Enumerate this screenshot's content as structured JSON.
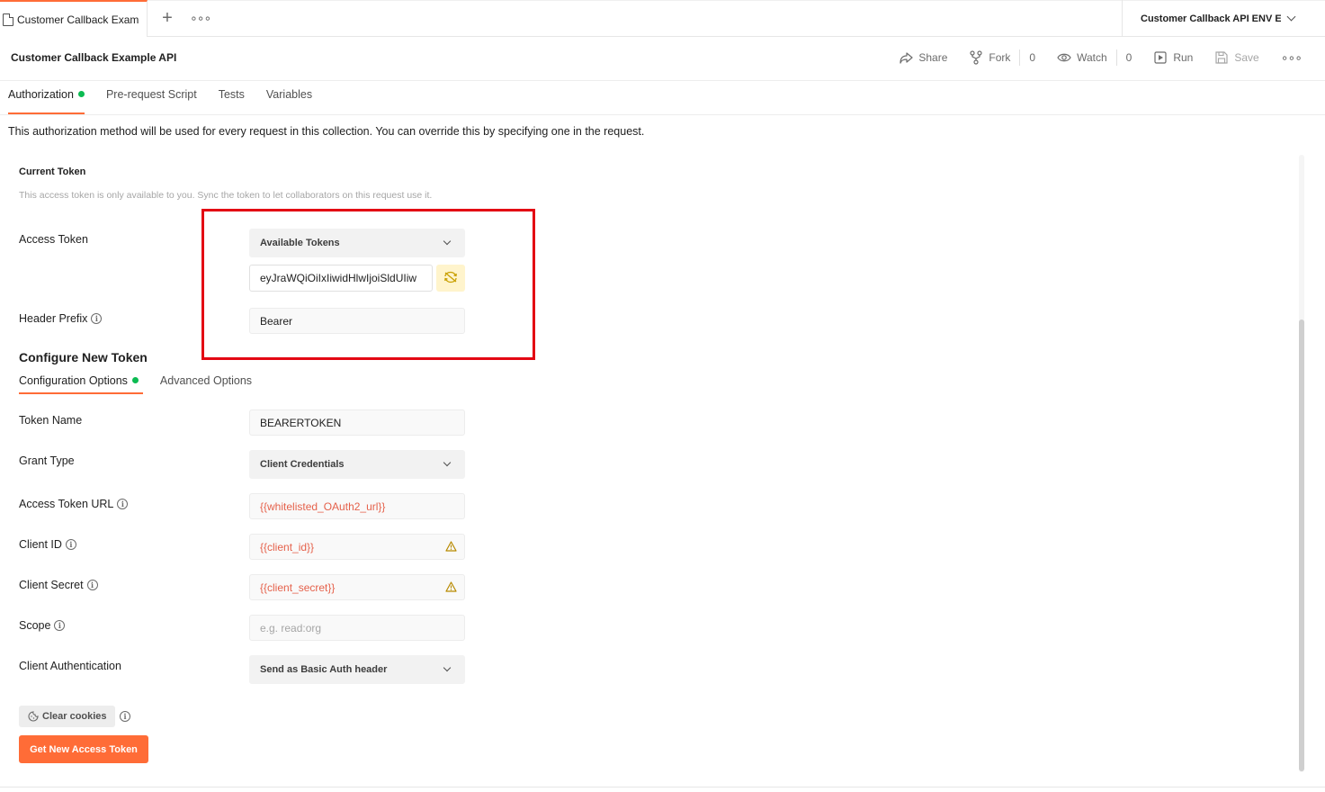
{
  "tabs": {
    "active_tab_label": "Customer Callback Example API",
    "new_tab_icon": "plus-icon",
    "more_icon": "more-horizontal-icon"
  },
  "environment": {
    "selected": "Customer Callback API ENV Example"
  },
  "header": {
    "title": "Customer Callback Example API",
    "share_label": "Share",
    "fork_label": "Fork",
    "fork_count": "0",
    "watch_label": "Watch",
    "watch_count": "0",
    "run_label": "Run",
    "save_label": "Save"
  },
  "subtabs": [
    "Authorization",
    "Pre-request Script",
    "Tests",
    "Variables"
  ],
  "description": "This authorization method will be used for every request in this collection. You can override this by specifying one in the request.",
  "current_token": {
    "heading": "Current Token",
    "hint": "This access token is only available to you. Sync the token to let collaborators on this request use it.",
    "access_token_label": "Access Token",
    "available_tokens": "Available Tokens",
    "token_value": "eyJraWQiOiIxIiwidHlwIjoiSldUIiw",
    "header_prefix_label": "Header Prefix",
    "header_prefix_value": "Bearer"
  },
  "configure": {
    "heading": "Configure New Token",
    "tabs": [
      "Configuration Options",
      "Advanced Options"
    ],
    "token_name_label": "Token Name",
    "token_name_value": "BEARERTOKEN",
    "grant_type_label": "Grant Type",
    "grant_type_value": "Client Credentials",
    "access_token_url_label": "Access Token URL",
    "access_token_url_value": "{{whitelisted_OAuth2_url}}",
    "client_id_label": "Client ID",
    "client_id_value": "{{client_id}}",
    "client_secret_label": "Client Secret",
    "client_secret_value": "{{client_secret}}",
    "scope_label": "Scope",
    "scope_placeholder": "e.g. read:org",
    "client_auth_label": "Client Authentication",
    "client_auth_value": "Send as Basic Auth header",
    "clear_cookies_label": "Clear cookies",
    "get_token_label": "Get New Access Token"
  },
  "colors": {
    "accent": "#ff6c37",
    "success_dot": "#0cbb52",
    "variable_text": "#e5614b",
    "highlight_box": "#e30613"
  }
}
